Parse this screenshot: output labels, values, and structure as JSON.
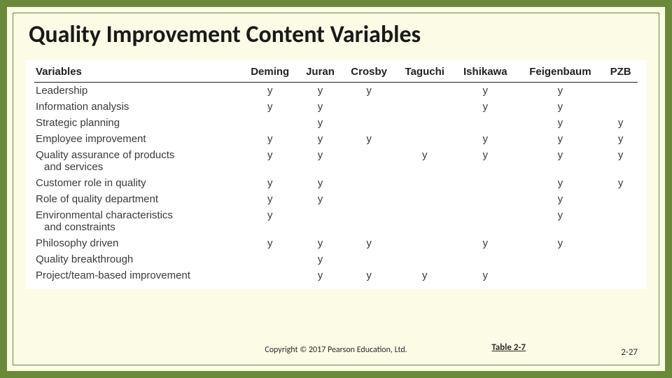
{
  "title": "Quality Improvement Content Variables",
  "copyright": "Copyright © 2017 Pearson Education, Ltd.",
  "table_label": "Table 2-7",
  "page_number": "2-27",
  "table": {
    "first_header": "Variables",
    "columns": [
      "Deming",
      "Juran",
      "Crosby",
      "Taguchi",
      "Ishikawa",
      "Feigenbaum",
      "PZB"
    ],
    "rows": [
      {
        "label": "Leadership",
        "cells": [
          "y",
          "y",
          "y",
          "",
          "y",
          "y",
          ""
        ]
      },
      {
        "label": "Information analysis",
        "cells": [
          "y",
          "y",
          "",
          "",
          "y",
          "y",
          ""
        ]
      },
      {
        "label": "Strategic planning",
        "cells": [
          "",
          "y",
          "",
          "",
          "",
          "y",
          "y"
        ]
      },
      {
        "label": "Employee improvement",
        "cells": [
          "y",
          "y",
          "y",
          "",
          "y",
          "y",
          "y"
        ]
      },
      {
        "label": "Quality assurance of products",
        "cont": "and services",
        "cells": [
          "y",
          "y",
          "",
          "y",
          "y",
          "y",
          "y"
        ]
      },
      {
        "label": "Customer role in quality",
        "cells": [
          "y",
          "y",
          "",
          "",
          "",
          "y",
          "y"
        ]
      },
      {
        "label": "Role of quality department",
        "cells": [
          "y",
          "y",
          "",
          "",
          "",
          "y",
          ""
        ]
      },
      {
        "label": "Environmental characteristics",
        "cont": "and constraints",
        "cells": [
          "y",
          "",
          "",
          "",
          "",
          "y",
          ""
        ]
      },
      {
        "label": "Philosophy driven",
        "cells": [
          "y",
          "y",
          "y",
          "",
          "y",
          "y",
          ""
        ]
      },
      {
        "label": "Quality breakthrough",
        "cells": [
          "",
          "y",
          "",
          "",
          "",
          "",
          ""
        ]
      },
      {
        "label": "Project/team-based improvement",
        "cells": [
          "",
          "y",
          "y",
          "y",
          "y",
          "",
          ""
        ]
      }
    ]
  }
}
